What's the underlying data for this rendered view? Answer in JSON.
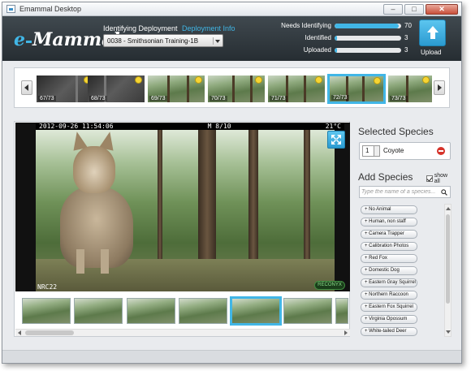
{
  "window": {
    "title": "Emammal Desktop"
  },
  "logo": {
    "e": "e",
    "name": "Mammal"
  },
  "header": {
    "identifying_label": "Identifying Deployment",
    "deployment_info_link": "Deployment Info",
    "deployment_selected": "0038 - Smithsonian Training-1B",
    "upload_label": "Upload"
  },
  "stats": [
    {
      "label": "Needs Identifying",
      "count": "70",
      "fraction": 0.96
    },
    {
      "label": "Identified",
      "count": "3",
      "fraction": 0.04
    },
    {
      "label": "Uploaded",
      "count": "3",
      "fraction": 0.04
    }
  ],
  "filmstrip": {
    "thumbs": [
      {
        "label": "67/73",
        "style": "dark"
      },
      {
        "label": "68/73",
        "style": "dark"
      },
      {
        "label": "69/73",
        "style": "green"
      },
      {
        "label": "70/73",
        "style": "green"
      },
      {
        "label": "71/73",
        "style": "green"
      },
      {
        "label": "72/73",
        "style": "green",
        "selected": true
      },
      {
        "label": "73/73",
        "style": "green"
      }
    ]
  },
  "photo": {
    "timestamp": "2012-09-26 11:54:06",
    "moon": "M 8/10",
    "temperature": "21°C",
    "camera_label": "NRC22",
    "brand": "RECONYX"
  },
  "selected_species": {
    "title": "Selected Species",
    "items": [
      {
        "qty": "1",
        "name": "Coyote"
      }
    ]
  },
  "add_species": {
    "title": "Add Species",
    "show_all_label": "show all",
    "search_placeholder": "Type the name of a species...",
    "items": [
      "+ No Animal",
      "+ Human, non staff",
      "+ Camera Trapper",
      "+ Calibration Photos",
      "+ Red Fox",
      "+ Domestic Dog",
      "+ Eastern Gray Squirrel",
      "+ Northern Raccoon",
      "+ Eastern Fox Squirrel",
      "+ Virginia Opossum",
      "+ White-tailed Deer"
    ]
  },
  "colors": {
    "accent": "#41b6e6",
    "header_bg": "#2f373c",
    "remove": "#d6332a",
    "badge": "#f6d533"
  }
}
